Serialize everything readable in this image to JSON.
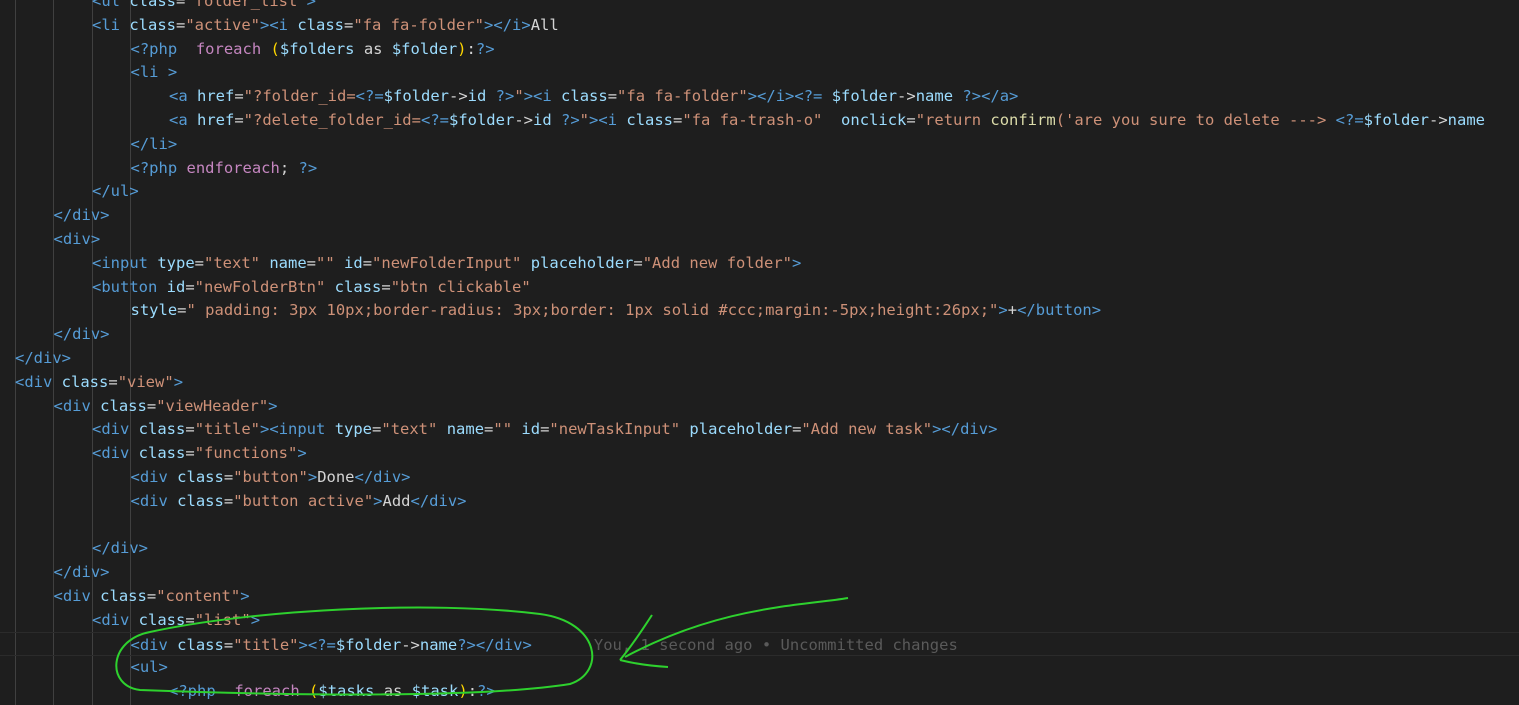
{
  "editor": {
    "lines": [
      {
        "indent": 2,
        "tokens": [
          [
            "tag",
            "<ul "
          ],
          [
            "attr",
            "class"
          ],
          [
            "text",
            "="
          ],
          [
            "str",
            "\"folder_list\""
          ],
          [
            "tag",
            ">"
          ]
        ]
      },
      {
        "indent": 2,
        "tokens": [
          [
            "tag",
            "<li "
          ],
          [
            "attr",
            "class"
          ],
          [
            "text",
            "="
          ],
          [
            "str",
            "\"active\""
          ],
          [
            "tag",
            ">"
          ],
          [
            "tag",
            "<i "
          ],
          [
            "attr",
            "class"
          ],
          [
            "text",
            "="
          ],
          [
            "str",
            "\"fa fa-folder\""
          ],
          [
            "tag",
            ">"
          ],
          [
            "tag",
            "</i>"
          ],
          [
            "text",
            "All"
          ]
        ]
      },
      {
        "indent": 3,
        "tokens": [
          [
            "php",
            "<?php"
          ],
          [
            "text",
            "  "
          ],
          [
            "kw",
            "foreach"
          ],
          [
            "text",
            " "
          ],
          [
            "paren",
            "("
          ],
          [
            "var",
            "$folders"
          ],
          [
            "text",
            " as "
          ],
          [
            "var",
            "$folder"
          ],
          [
            "paren",
            ")"
          ],
          [
            "text",
            ":"
          ],
          [
            "php",
            "?>"
          ]
        ]
      },
      {
        "indent": 3,
        "tokens": [
          [
            "tag",
            "<li "
          ],
          [
            "tag",
            ">"
          ]
        ]
      },
      {
        "indent": 4,
        "tokens": [
          [
            "tag",
            "<a "
          ],
          [
            "attr",
            "href"
          ],
          [
            "text",
            "="
          ],
          [
            "str",
            "\"?folder_id="
          ],
          [
            "php",
            "<?="
          ],
          [
            "var",
            "$folder"
          ],
          [
            "text",
            "->"
          ],
          [
            "var",
            "id"
          ],
          [
            "text",
            " "
          ],
          [
            "php",
            "?>"
          ],
          [
            "str",
            "\""
          ],
          [
            "tag",
            ">"
          ],
          [
            "tag",
            "<i "
          ],
          [
            "attr",
            "class"
          ],
          [
            "text",
            "="
          ],
          [
            "str",
            "\"fa fa-folder\""
          ],
          [
            "tag",
            ">"
          ],
          [
            "tag",
            "</i>"
          ],
          [
            "php",
            "<?="
          ],
          [
            "text",
            " "
          ],
          [
            "var",
            "$folder"
          ],
          [
            "text",
            "->"
          ],
          [
            "var",
            "name"
          ],
          [
            "text",
            " "
          ],
          [
            "php",
            "?>"
          ],
          [
            "tag",
            "</a>"
          ]
        ]
      },
      {
        "indent": 4,
        "tokens": [
          [
            "tag",
            "<a "
          ],
          [
            "attr",
            "href"
          ],
          [
            "text",
            "="
          ],
          [
            "str",
            "\"?delete_folder_id="
          ],
          [
            "php",
            "<?="
          ],
          [
            "var",
            "$folder"
          ],
          [
            "text",
            "->"
          ],
          [
            "var",
            "id"
          ],
          [
            "text",
            " "
          ],
          [
            "php",
            "?>"
          ],
          [
            "str",
            "\""
          ],
          [
            "tag",
            ">"
          ],
          [
            "tag",
            "<i "
          ],
          [
            "attr",
            "class"
          ],
          [
            "text",
            "="
          ],
          [
            "str",
            "\"fa fa-trash-o\""
          ],
          [
            "text",
            "  "
          ],
          [
            "attr",
            "onclick"
          ],
          [
            "text",
            "="
          ],
          [
            "str",
            "\"return "
          ],
          [
            "fn",
            "confirm"
          ],
          [
            "str",
            "('are you sure to delete ---> "
          ],
          [
            "php",
            "<?="
          ],
          [
            "var",
            "$folder"
          ],
          [
            "text",
            "->"
          ],
          [
            "var",
            "name"
          ]
        ]
      },
      {
        "indent": 3,
        "tokens": [
          [
            "tag",
            "</li>"
          ]
        ]
      },
      {
        "indent": 3,
        "tokens": [
          [
            "php",
            "<?php"
          ],
          [
            "text",
            " "
          ],
          [
            "kw",
            "endforeach"
          ],
          [
            "text",
            "; "
          ],
          [
            "php",
            "?>"
          ]
        ]
      },
      {
        "indent": 2,
        "tokens": [
          [
            "tag",
            "</ul>"
          ]
        ]
      },
      {
        "indent": 1,
        "tokens": [
          [
            "tag",
            "</div>"
          ]
        ]
      },
      {
        "indent": 1,
        "tokens": [
          [
            "tag",
            "<div>"
          ]
        ]
      },
      {
        "indent": 2,
        "tokens": [
          [
            "tag",
            "<input "
          ],
          [
            "attr",
            "type"
          ],
          [
            "text",
            "="
          ],
          [
            "str",
            "\"text\""
          ],
          [
            "text",
            " "
          ],
          [
            "attr",
            "name"
          ],
          [
            "text",
            "="
          ],
          [
            "str",
            "\"\""
          ],
          [
            "text",
            " "
          ],
          [
            "attr",
            "id"
          ],
          [
            "text",
            "="
          ],
          [
            "str",
            "\"newFolderInput\""
          ],
          [
            "text",
            " "
          ],
          [
            "attr",
            "placeholder"
          ],
          [
            "text",
            "="
          ],
          [
            "str",
            "\"Add new folder\""
          ],
          [
            "tag",
            ">"
          ]
        ]
      },
      {
        "indent": 2,
        "tokens": [
          [
            "tag",
            "<button "
          ],
          [
            "attr",
            "id"
          ],
          [
            "text",
            "="
          ],
          [
            "str",
            "\"newFolderBtn\""
          ],
          [
            "text",
            " "
          ],
          [
            "attr",
            "class"
          ],
          [
            "text",
            "="
          ],
          [
            "str",
            "\"btn clickable\""
          ]
        ]
      },
      {
        "indent": 3,
        "tokens": [
          [
            "attr",
            "style"
          ],
          [
            "text",
            "="
          ],
          [
            "str",
            "\" padding: 3px 10px;border-radius: 3px;border: 1px solid #ccc;margin:-5px;height:26px;\""
          ],
          [
            "tag",
            ">"
          ],
          [
            "text",
            "+"
          ],
          [
            "tag",
            "</button>"
          ]
        ]
      },
      {
        "indent": 1,
        "tokens": [
          [
            "tag",
            "</div>"
          ]
        ]
      },
      {
        "indent": 0,
        "tokens": [
          [
            "tag",
            "</div>"
          ]
        ]
      },
      {
        "indent": 0,
        "tokens": [
          [
            "tag",
            "<div "
          ],
          [
            "attr",
            "class"
          ],
          [
            "text",
            "="
          ],
          [
            "str",
            "\"view\""
          ],
          [
            "tag",
            ">"
          ]
        ]
      },
      {
        "indent": 1,
        "tokens": [
          [
            "tag",
            "<div "
          ],
          [
            "attr",
            "class"
          ],
          [
            "text",
            "="
          ],
          [
            "str",
            "\"viewHeader\""
          ],
          [
            "tag",
            ">"
          ]
        ]
      },
      {
        "indent": 2,
        "tokens": [
          [
            "tag",
            "<div "
          ],
          [
            "attr",
            "class"
          ],
          [
            "text",
            "="
          ],
          [
            "str",
            "\"title\""
          ],
          [
            "tag",
            ">"
          ],
          [
            "tag",
            "<input "
          ],
          [
            "attr",
            "type"
          ],
          [
            "text",
            "="
          ],
          [
            "str",
            "\"text\""
          ],
          [
            "text",
            " "
          ],
          [
            "attr",
            "name"
          ],
          [
            "text",
            "="
          ],
          [
            "str",
            "\"\""
          ],
          [
            "text",
            " "
          ],
          [
            "attr",
            "id"
          ],
          [
            "text",
            "="
          ],
          [
            "str",
            "\"newTaskInput\""
          ],
          [
            "text",
            " "
          ],
          [
            "attr",
            "placeholder"
          ],
          [
            "text",
            "="
          ],
          [
            "str",
            "\"Add new task\""
          ],
          [
            "tag",
            ">"
          ],
          [
            "tag",
            "</div>"
          ]
        ]
      },
      {
        "indent": 2,
        "tokens": [
          [
            "tag",
            "<div "
          ],
          [
            "attr",
            "class"
          ],
          [
            "text",
            "="
          ],
          [
            "str",
            "\"functions\""
          ],
          [
            "tag",
            ">"
          ]
        ]
      },
      {
        "indent": 3,
        "tokens": [
          [
            "tag",
            "<div "
          ],
          [
            "attr",
            "class"
          ],
          [
            "text",
            "="
          ],
          [
            "str",
            "\"button\""
          ],
          [
            "tag",
            ">"
          ],
          [
            "text",
            "Done"
          ],
          [
            "tag",
            "</div>"
          ]
        ]
      },
      {
        "indent": 3,
        "tokens": [
          [
            "tag",
            "<div "
          ],
          [
            "attr",
            "class"
          ],
          [
            "text",
            "="
          ],
          [
            "str",
            "\"button active\""
          ],
          [
            "tag",
            ">"
          ],
          [
            "text",
            "Add"
          ],
          [
            "tag",
            "</div>"
          ]
        ]
      },
      {
        "indent": 0,
        "tokens": []
      },
      {
        "indent": 2,
        "tokens": [
          [
            "tag",
            "</div>"
          ]
        ]
      },
      {
        "indent": 1,
        "tokens": [
          [
            "tag",
            "</div>"
          ]
        ]
      },
      {
        "indent": 1,
        "tokens": [
          [
            "tag",
            "<div "
          ],
          [
            "attr",
            "class"
          ],
          [
            "text",
            "="
          ],
          [
            "str",
            "\"content\""
          ],
          [
            "tag",
            ">"
          ]
        ]
      },
      {
        "indent": 2,
        "tokens": [
          [
            "tag",
            "<div "
          ],
          [
            "attr",
            "class"
          ],
          [
            "text",
            "="
          ],
          [
            "str",
            "\"list\""
          ],
          [
            "tag",
            ">"
          ]
        ]
      },
      {
        "indent": 3,
        "current": true,
        "tokens": [
          [
            "tag",
            "<div "
          ],
          [
            "attr",
            "class"
          ],
          [
            "text",
            "="
          ],
          [
            "str",
            "\"title\""
          ],
          [
            "tag",
            ">"
          ],
          [
            "php",
            "<?="
          ],
          [
            "var",
            "$folder"
          ],
          [
            "text",
            "->"
          ],
          [
            "var",
            "name"
          ],
          [
            "php",
            "?>"
          ],
          [
            "tag",
            "</div>"
          ]
        ],
        "blame": "You, 1 second ago • Uncommitted changes"
      },
      {
        "indent": 3,
        "tokens": [
          [
            "tag",
            "<ul>"
          ]
        ]
      },
      {
        "indent": 4,
        "tokens": [
          [
            "php",
            "<?php"
          ],
          [
            "text",
            "  "
          ],
          [
            "kw",
            "foreach"
          ],
          [
            "text",
            " "
          ],
          [
            "paren",
            "("
          ],
          [
            "var",
            "$tasks"
          ],
          [
            "text",
            " as "
          ],
          [
            "var",
            "$task"
          ],
          [
            "paren",
            ")"
          ],
          [
            "text",
            ":"
          ],
          [
            "php",
            "?>"
          ]
        ]
      }
    ]
  },
  "annotation": {
    "color": "#22dd22",
    "shape": "circle-and-arrow"
  }
}
